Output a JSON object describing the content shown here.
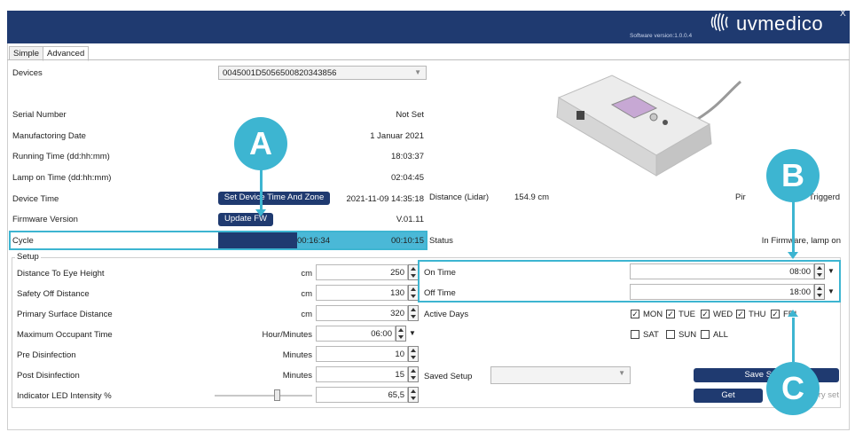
{
  "app": {
    "logo_text": "uvmedico",
    "software_version": "Software version:1.0.0.4",
    "close": "X"
  },
  "tabs": [
    {
      "label": "Simple"
    },
    {
      "label": "Advanced"
    }
  ],
  "devices": {
    "label": "Devices",
    "selected": "0045001D5056500820343856"
  },
  "info": {
    "serial_label": "Serial Number",
    "serial_value": "Not Set",
    "mfg_label": "Manufactoring Date",
    "mfg_value": "1 Januar 2021",
    "running_label": "Running Time (dd:hh:mm)",
    "running_value": "18:03:37",
    "lamp_label": "Lamp on Time (dd:hh:mm)",
    "lamp_value": "02:04:45",
    "device_time_label": "Device Time",
    "set_time_button": "Set Device Time And Zone",
    "device_time_value": "2021-11-09 14:35:18",
    "firmware_label": "Firmware Version",
    "update_button": "Update FW",
    "firmware_value": "V.01.11",
    "cycle_label": "Cycle",
    "cycle_time_1": "00:16:34",
    "cycle_time_2": "00:10:15",
    "cycle_progress": 0.38
  },
  "sensors": {
    "distance_label": "Distance (Lidar)",
    "distance_value": "154.9 cm",
    "pir_label": "Pir",
    "pir_value": "Triggerd",
    "status_label": "Status",
    "status_value": "In Firmware, lamp on"
  },
  "setup": {
    "title": "Setup",
    "rows": [
      {
        "label": "Distance To Eye Height",
        "unit": "cm",
        "value": "250"
      },
      {
        "label": "Safety Off Distance",
        "unit": "cm",
        "value": "130"
      },
      {
        "label": "Primary Surface Distance",
        "unit": "cm",
        "value": "320"
      },
      {
        "label": "Maximum Occupant Time",
        "unit": "Hour/Minutes",
        "value": "06:00"
      },
      {
        "label": "Pre Disinfection",
        "unit": "Minutes",
        "value": "10"
      },
      {
        "label": "Post Disinfection",
        "unit": "Minutes",
        "value": "15"
      },
      {
        "label": "Indicator LED Intensity %",
        "unit": "",
        "value": "65,5"
      }
    ],
    "on_time_label": "On Time",
    "on_time_value": "08:00",
    "off_time_label": "Off Time",
    "off_time_value": "18:00",
    "active_days_label": "Active Days",
    "days": [
      {
        "label": "MON",
        "checked": true
      },
      {
        "label": "TUE",
        "checked": true
      },
      {
        "label": "WED",
        "checked": true
      },
      {
        "label": "THU",
        "checked": true
      },
      {
        "label": "FRI",
        "checked": true
      },
      {
        "label": "SAT",
        "checked": false
      },
      {
        "label": "SUN",
        "checked": false
      },
      {
        "label": "ALL",
        "checked": false
      }
    ],
    "saved_setup_label": "Saved Setup",
    "save_button": "Save Setup",
    "get_button": "Get",
    "factory_set": "Factory set",
    "led_intensity_level": 0.65
  },
  "callouts": [
    "A",
    "B",
    "C"
  ],
  "colors": {
    "brand_navy": "#1f3a70",
    "highlight_cyan": "#3db5d1"
  }
}
